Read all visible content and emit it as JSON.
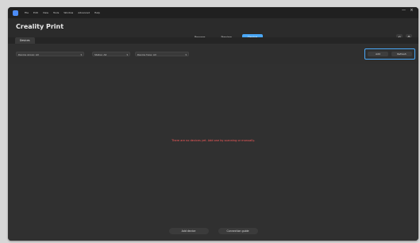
{
  "app": {
    "menu": [
      "File",
      "Edit",
      "View",
      "Tools",
      "Window",
      "Advanced",
      "Help"
    ],
    "title": "Creality Print",
    "mode_tabs": [
      "Prepare",
      "Preview",
      "Device"
    ],
    "active_mode_index": 2,
    "window_controls": [
      "—",
      "×"
    ],
    "corner_buttons": [
      "⟲",
      "⚙"
    ]
  },
  "tabs": [
    "Devices"
  ],
  "toolbar": {
    "filters": [
      {
        "label": "Device group",
        "value": "All"
      },
      {
        "label": "Status",
        "value": "All"
      },
      {
        "label": "Device type",
        "value": "All"
      }
    ],
    "actions": [
      "Add",
      "Refresh"
    ]
  },
  "main": {
    "message": "There are no devices yet. Add one by scanning or manually.",
    "bottom_buttons": [
      "Add device",
      "Connection guide"
    ]
  },
  "colors": {
    "accent": "#4aa7f6",
    "message": "#ff5b5b",
    "background": "#303030"
  }
}
